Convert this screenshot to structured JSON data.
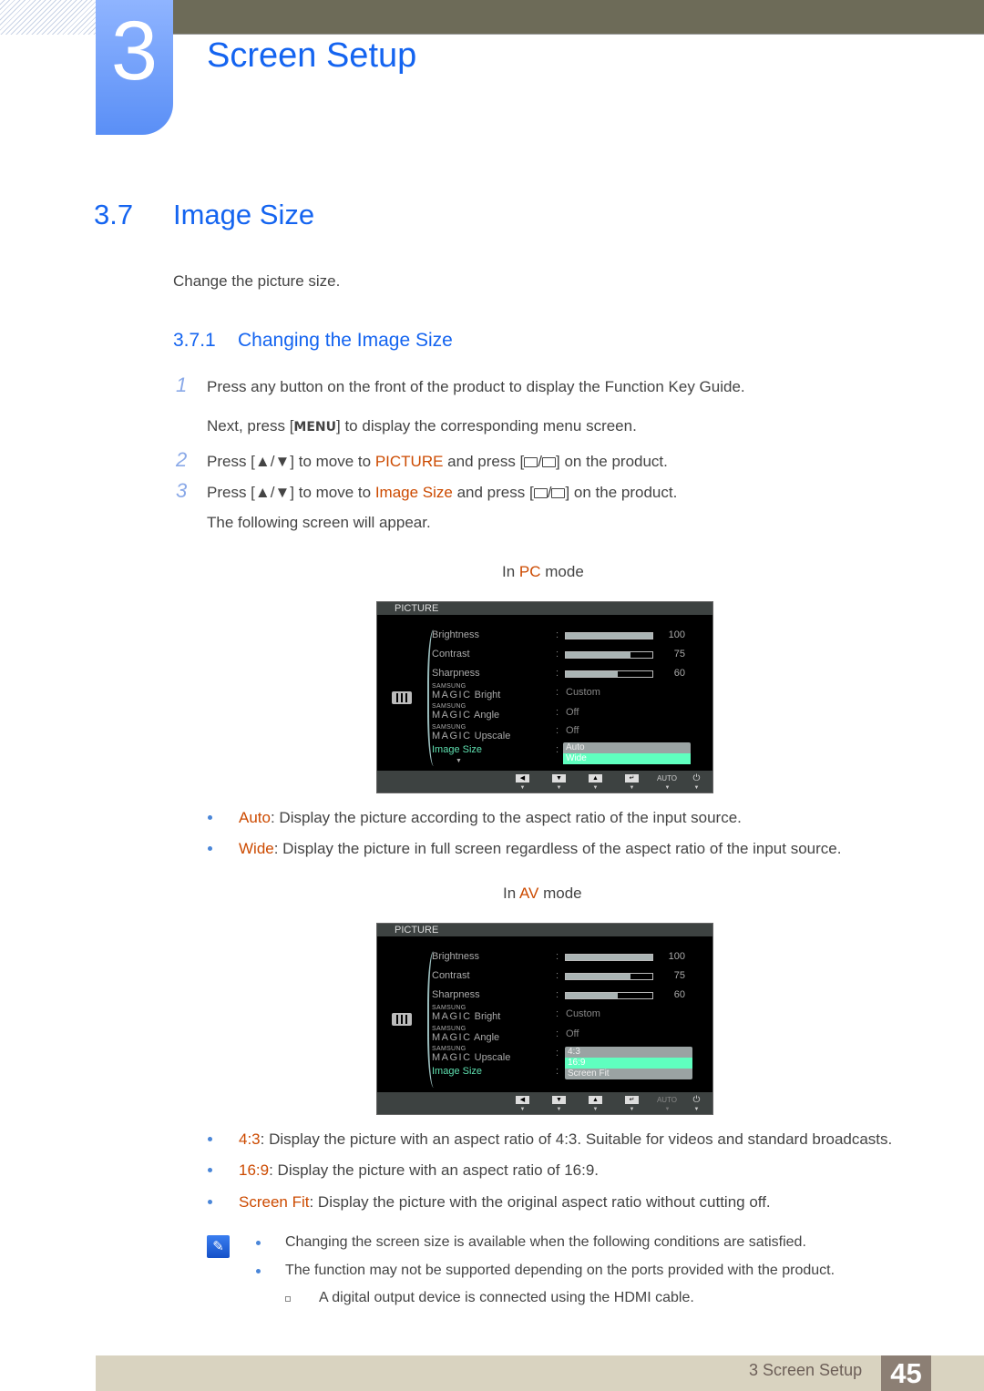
{
  "chapter": {
    "number": "3",
    "title": "Screen Setup"
  },
  "section": {
    "number": "3.7",
    "title": "Image Size",
    "intro": "Change the picture size."
  },
  "subsection": {
    "number": "3.7.1",
    "title": "Changing the Image Size"
  },
  "steps": [
    {
      "num": "1",
      "text": "Press any button on the front of the product to display the Function Key Guide.",
      "sub": [
        "Next, press [",
        "MENU",
        "] to display the corresponding menu screen."
      ]
    },
    {
      "num": "2",
      "pre": "Press [▲/▼] to move to ",
      "hl": "PICTURE",
      "post": " and press [",
      "tail": "] on the product."
    },
    {
      "num": "3",
      "pre": "Press [▲/▼] to move to ",
      "hl": "Image Size",
      "post": " and press [",
      "tail": "] on the product.",
      "after": "The following screen will appear."
    }
  ],
  "pc_mode": {
    "label_pre": "In ",
    "mode": "PC",
    "label_post": " mode"
  },
  "av_mode": {
    "label_pre": "In ",
    "mode": "AV",
    "label_post": " mode"
  },
  "osd": {
    "header": "PICTURE",
    "brightness": {
      "label": "Brightness",
      "value": 100
    },
    "contrast": {
      "label": "Contrast",
      "value": 75
    },
    "sharpness": {
      "label": "Sharpness",
      "value": 60
    },
    "magic_top": "SAMSUNG",
    "magic_word": "MAGIC",
    "bright": {
      "label": "Bright",
      "value": "Custom"
    },
    "angle": {
      "label": "Angle",
      "value": "Off"
    },
    "upscale": {
      "label": "Upscale",
      "value": "Off"
    },
    "image_size": "Image Size",
    "colon": ":",
    "auto_key": "AUTO",
    "pc_options": [
      "Auto",
      "Wide"
    ],
    "pc_selected": "Wide",
    "av_options": [
      "4:3",
      "16:9",
      "Screen Fit"
    ],
    "av_selected": "16:9"
  },
  "pc_bullets": [
    {
      "term": "Auto",
      "text": ": Display the picture according to the aspect ratio of the input source."
    },
    {
      "term": "Wide",
      "text": ": Display the picture in full screen regardless of the aspect ratio of the input source."
    }
  ],
  "av_bullets": [
    {
      "term": "4:3",
      "text": ": Display the picture with an aspect ratio of 4:3. Suitable for videos and standard broadcasts."
    },
    {
      "term": "16:9",
      "text": ": Display the picture with an aspect ratio of 16:9."
    },
    {
      "term": "Screen Fit",
      "text": ": Display the picture with the original aspect ratio without cutting off."
    }
  ],
  "notes": [
    "Changing the screen size is available when the following conditions are satisfied.",
    "The function may not be supported depending on the ports provided with the product."
  ],
  "subnote": "A digital output device is connected using the HDMI cable.",
  "footer": {
    "text": "3 Screen Setup",
    "page": "45"
  }
}
